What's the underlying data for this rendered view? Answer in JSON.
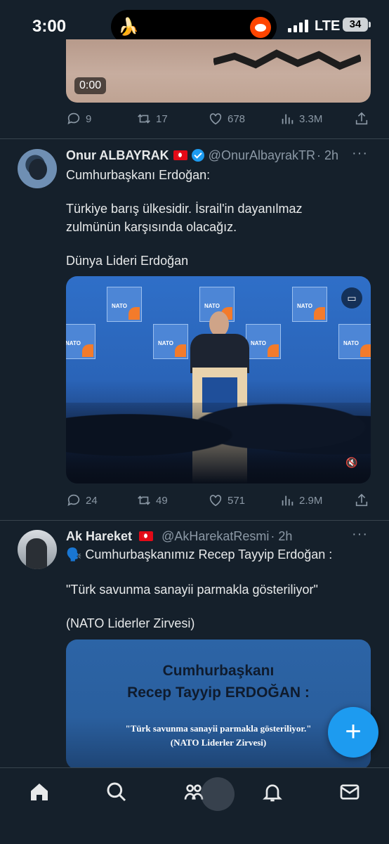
{
  "status_bar": {
    "time": "3:00",
    "carrier": "LTE",
    "battery": "34"
  },
  "tweets": [
    {
      "video_time": "0:00",
      "replies": "9",
      "retweets": "17",
      "likes": "678",
      "views": "3.3M"
    },
    {
      "name": "Onur ALBAYRAK",
      "handle": "@OnurAlbayrakTR",
      "time": "· 2h",
      "text_line1": "Cumhurbaşkanı Erdoğan:",
      "text_line2": "Türkiye barış ülkesidir. İsrail'in dayanılmaz",
      "text_line3": "zulmünün karşısında olacağız.",
      "text_line4": "Dünya Lideri Erdoğan",
      "replies": "24",
      "retweets": "49",
      "likes": "571",
      "views": "2.9M"
    },
    {
      "name": "Ak Hareket",
      "handle": "@AkHarekatResmi",
      "time": "· 2h",
      "text_line1": "🗣️ Cumhurbaşkanımız Recep Tayyip Erdoğan :",
      "text_line2": "\"Türk savunma sanayii parmakla gösteriliyor\"",
      "text_line3": "(NATO Liderler Zirvesi)",
      "media_line1": "Cumhurbaşkanı",
      "media_line2": "Recep Tayyip ERDOĞAN :",
      "media_line3": "\"Türk savunma sanayii parmakla gösteriliyor.\"",
      "media_line4": "(NATO Liderler Zirvesi)"
    }
  ],
  "fab_label": "+",
  "nav": [
    "home-icon",
    "search-icon",
    "communities-icon",
    "notifications-icon",
    "messages-icon"
  ],
  "colors": {
    "background": "#15202b",
    "accent": "#1d9bf0",
    "muted": "#8b98a5"
  }
}
